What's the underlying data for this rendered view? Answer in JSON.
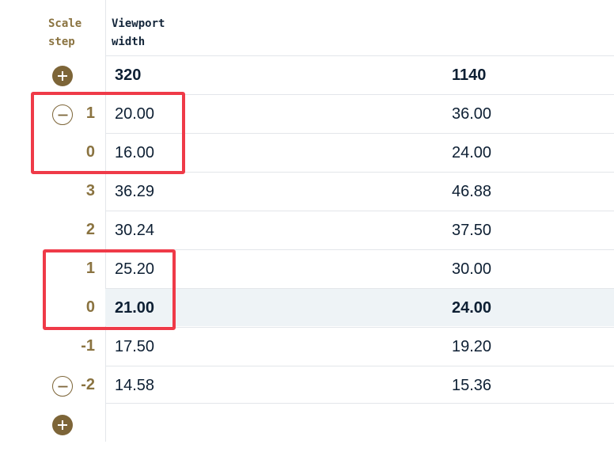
{
  "header": {
    "step_line1": "Scale",
    "step_line2": "step",
    "viewport_line1": "Viewport",
    "viewport_line2": "width"
  },
  "viewport_widths": {
    "min": "320",
    "max": "1140"
  },
  "rows": [
    {
      "step": "1",
      "v320": "20.00",
      "v1140": "36.00"
    },
    {
      "step": "0",
      "v320": "16.00",
      "v1140": "24.00"
    },
    {
      "step": "3",
      "v320": "36.29",
      "v1140": "46.88"
    },
    {
      "step": "2",
      "v320": "30.24",
      "v1140": "37.50"
    },
    {
      "step": "1",
      "v320": "25.20",
      "v1140": "30.00"
    },
    {
      "step": "0",
      "v320": "21.00",
      "v1140": "24.00"
    },
    {
      "step": "-1",
      "v320": "17.50",
      "v1140": "19.20"
    },
    {
      "step": "-2",
      "v320": "14.58",
      "v1140": "15.36"
    }
  ],
  "colors": {
    "accent": "#7d6538",
    "step_text": "#8a7340",
    "highlight": "#ef3a48",
    "shaded_row": "#eef3f6"
  },
  "icons": {
    "add_top": "plus-icon",
    "remove_upper": "minus-icon",
    "remove_lower": "minus-icon",
    "add_bottom": "plus-icon"
  }
}
